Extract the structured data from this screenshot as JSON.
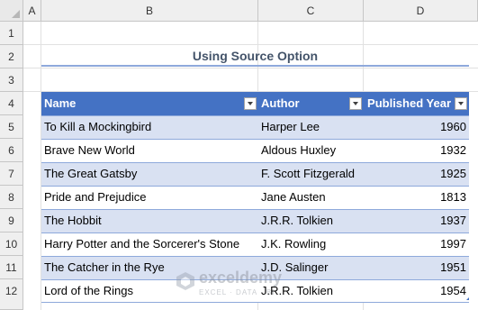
{
  "columns": [
    "A",
    "B",
    "C",
    "D"
  ],
  "rows": [
    "1",
    "2",
    "3",
    "4",
    "5",
    "6",
    "7",
    "8",
    "9",
    "10",
    "11",
    "12"
  ],
  "title": "Using Source Option",
  "table": {
    "headers": [
      "Name",
      "Author",
      "Published Year"
    ],
    "rows": [
      [
        "To Kill a Mockingbird",
        "Harper Lee",
        "1960"
      ],
      [
        "Brave New World",
        "Aldous Huxley",
        "1932"
      ],
      [
        "The Great Gatsby",
        "F. Scott Fitzgerald",
        "1925"
      ],
      [
        "Pride and Prejudice",
        "Jane Austen",
        "1813"
      ],
      [
        "The Hobbit",
        "J.R.R. Tolkien",
        "1937"
      ],
      [
        "Harry Potter and the Sorcerer's Stone",
        "J.K. Rowling",
        "1997"
      ],
      [
        "The Catcher in the Rye",
        "J.D. Salinger",
        "1951"
      ],
      [
        "Lord of the Rings",
        "J.R.R. Tolkien",
        "1954"
      ]
    ]
  },
  "watermark": {
    "name": "exceldemy",
    "tagline": "EXCEL · DATA · BI"
  },
  "colors": {
    "header": "#4472c4",
    "band": "#d9e1f2",
    "title": "#44546a",
    "accent_line": "#8ea9db"
  }
}
